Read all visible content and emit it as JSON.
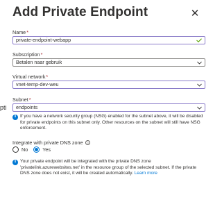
{
  "header": {
    "title": "Add Private Endpoint",
    "close_glyph": "✕"
  },
  "edge_text": "pti",
  "fields": {
    "name": {
      "label": "Name",
      "required": "*",
      "value": "private-endpoint-webapp"
    },
    "subscription": {
      "label": "Subscription",
      "required": "*",
      "value": "Betalen naar gebruik"
    },
    "vnet": {
      "label": "Virtual network",
      "required": "*",
      "value": "vnet-temp-dev-weu"
    },
    "subnet": {
      "label": "Subnet",
      "required": "*",
      "value": "endpoints"
    }
  },
  "nsg_info": {
    "icon": "i",
    "text": "If you have a network security group (NSG) enabled for the subnet above, it will be disabled for private endpoints on this subnet only. Other resources on the subnet will still have NSG enforcement."
  },
  "dns": {
    "label": "Integrate with private DNS zone",
    "tooltip_glyph": "i",
    "options": [
      {
        "label": "No",
        "selected": false
      },
      {
        "label": "Yes",
        "selected": true
      }
    ]
  },
  "dns_info": {
    "icon": "i",
    "text": "Your private endpoint will be integrated with the private DNS zone 'privatelink.azurewebsites.net' in the resource group of the selected subnet. If the private DNS zone does not exist, it will be created automatically.",
    "link": "Learn more"
  },
  "colors": {
    "accent": "#0078d4",
    "focus_border": "#8a7cc9",
    "required": "#a4262c",
    "valid": "#57a300"
  },
  "icons": {
    "close": "close-icon",
    "valid": "checkmark-icon",
    "dropdown": "chevron-down-icon",
    "info": "info-icon",
    "tooltip": "info-tooltip-icon"
  }
}
